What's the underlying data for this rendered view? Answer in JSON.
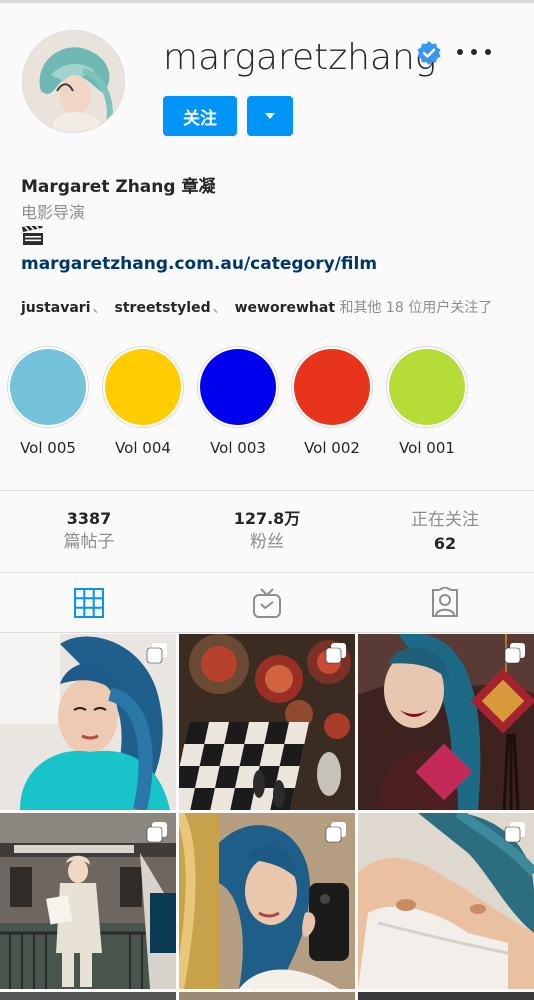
{
  "profile": {
    "username": "margaretzhang",
    "follow_label": "关注",
    "full_name": "Margaret Zhang 章凝",
    "category": "电影导演",
    "bio_emoji": "clapper-board-icon",
    "website": "margaretzhang.com.au/category/film",
    "followed_by": {
      "users": [
        "justavari",
        "streetstyled",
        "weworewhat"
      ],
      "separator": "、",
      "suffix": "和其他 18 位用户关注了"
    }
  },
  "highlights": [
    {
      "label": "Vol 005",
      "color": "#74c3da"
    },
    {
      "label": "Vol 004",
      "color": "#ffcc00"
    },
    {
      "label": "Vol 003",
      "color": "#0000ee"
    },
    {
      "label": "Vol 002",
      "color": "#e8341c"
    },
    {
      "label": "Vol 001",
      "color": "#b5dc37"
    }
  ],
  "stats": {
    "posts": {
      "value": "3387",
      "label": "篇帖子"
    },
    "followers": {
      "value": "127.8万",
      "label": "粉丝"
    },
    "following": {
      "label": "正在关注",
      "value": "62"
    }
  },
  "tabs": [
    {
      "name": "posts-grid",
      "icon": "grid-icon",
      "active": true
    },
    {
      "name": "igtv",
      "icon": "tv-icon",
      "active": false
    },
    {
      "name": "tagged",
      "icon": "tagged-person-icon",
      "active": false
    }
  ],
  "colors": {
    "accent": "#0095f6",
    "link": "#00376b",
    "muted": "#8e8e8e",
    "verified": "#3897f0"
  },
  "posts": [
    {
      "desc": "portrait-blue-hair-teal-sweater",
      "multi": true
    },
    {
      "desc": "chess-and-pomegranates",
      "multi": true
    },
    {
      "desc": "red-lips-fu-charm",
      "multi": true
    },
    {
      "desc": "trattoria-dona-onesta-street",
      "multi": true
    },
    {
      "desc": "mirror-selfie",
      "multi": true
    },
    {
      "desc": "white-top-blue-hair",
      "multi": true
    }
  ]
}
